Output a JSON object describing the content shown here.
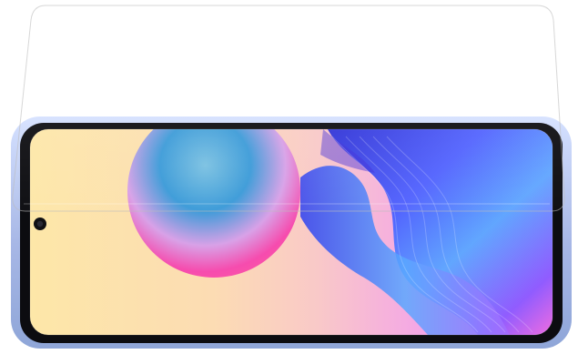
{
  "product": {
    "kind": "smartphone-with-screen-protector",
    "orientation": "landscape",
    "camera": "punch-hole",
    "camera_side": "left"
  },
  "protector": {
    "state": "floating-above-display",
    "finish": "clear-glass"
  },
  "phone": {
    "frame_color": "#8fa6d8",
    "bezel_color": "#0c0c10"
  },
  "wallpaper": {
    "style": "abstract-gradient",
    "background_colors": [
      "#fde7a8",
      "#f9c9c8",
      "#f4a6e6",
      "#c58bf0"
    ],
    "orb_colors": [
      "#3c9bd8",
      "#7bc1e2",
      "#d8a1e7",
      "#f64cae",
      "#ff5aa3"
    ],
    "wave_colors": [
      "#2b2fd6",
      "#4f62ff",
      "#5fa6ff",
      "#8f5bff",
      "#f06be1"
    ]
  }
}
